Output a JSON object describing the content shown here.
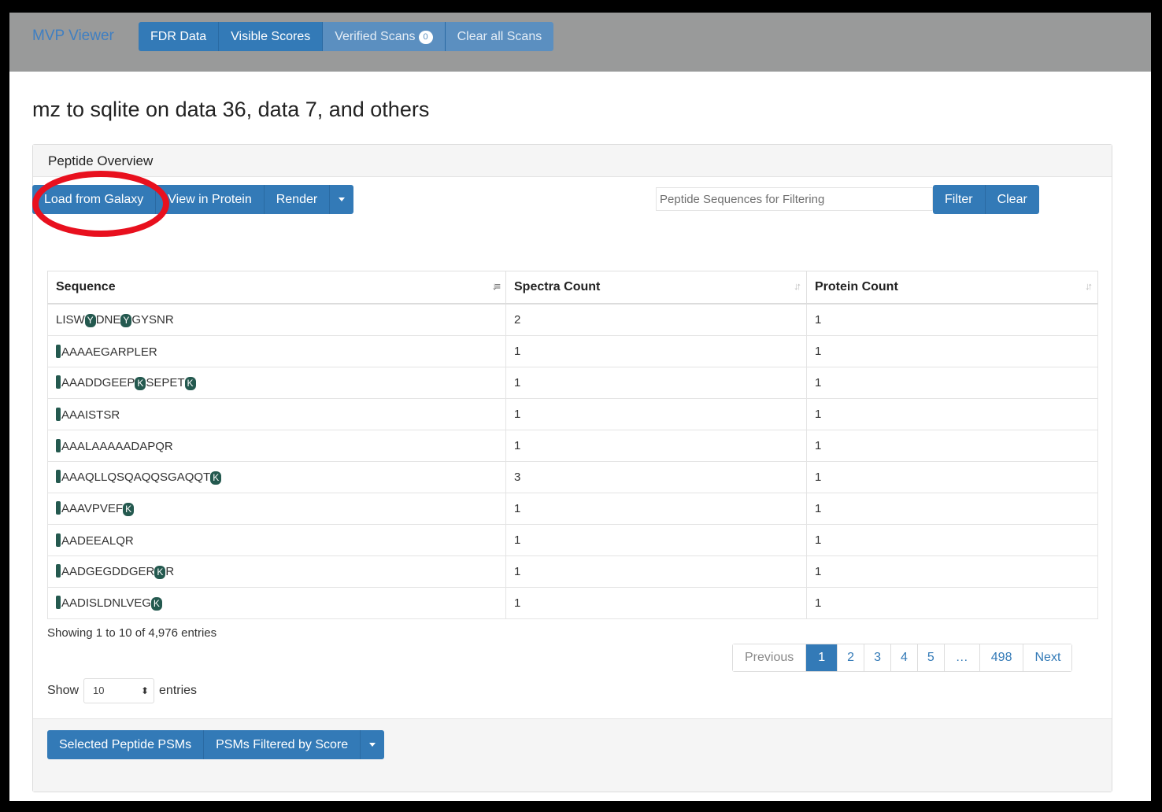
{
  "navbar": {
    "brand": "MVP Viewer",
    "items": [
      {
        "label": "FDR Data"
      },
      {
        "label": "Visible Scores"
      },
      {
        "label": "Verified Scans",
        "badge": "0"
      },
      {
        "label": "Clear all Scans"
      }
    ]
  },
  "page": {
    "title": "mz to sqlite on data 36, data 7, and others"
  },
  "panel": {
    "title": "Peptide Overview",
    "toolbar": {
      "load_label": "Load from Galaxy",
      "view_label": "View in Protein",
      "render_label": "Render"
    },
    "filter": {
      "placeholder": "Peptide Sequences for Filtering",
      "filter_label": "Filter",
      "clear_label": "Clear"
    },
    "highlight_color": "#e8101e",
    "table": {
      "columns": [
        "Sequence",
        "Spectra Count",
        "Protein Count"
      ],
      "rows": [
        {
          "sequence": [
            {
              "t": "LISW"
            },
            {
              "m": "Y"
            },
            {
              "t": "DNE"
            },
            {
              "m": "Y"
            },
            {
              "t": "GYSNR"
            }
          ],
          "spectra": "2",
          "protein": "1"
        },
        {
          "sequence": [
            {
              "n": true
            },
            {
              "t": "AAAAEGARPLER"
            }
          ],
          "spectra": "1",
          "protein": "1"
        },
        {
          "sequence": [
            {
              "n": true
            },
            {
              "t": "AAADDGEEP"
            },
            {
              "m": "K"
            },
            {
              "t": "SEPET"
            },
            {
              "m": "K"
            }
          ],
          "spectra": "1",
          "protein": "1"
        },
        {
          "sequence": [
            {
              "n": true
            },
            {
              "t": "AAAISTSR"
            }
          ],
          "spectra": "1",
          "protein": "1"
        },
        {
          "sequence": [
            {
              "n": true
            },
            {
              "t": "AAALAAAAADAPQR"
            }
          ],
          "spectra": "1",
          "protein": "1"
        },
        {
          "sequence": [
            {
              "n": true
            },
            {
              "t": "AAAQLLQSQAQQSGAQQT"
            },
            {
              "m": "K"
            }
          ],
          "spectra": "3",
          "protein": "1"
        },
        {
          "sequence": [
            {
              "n": true
            },
            {
              "t": "AAAVPVEF"
            },
            {
              "m": "K"
            }
          ],
          "spectra": "1",
          "protein": "1"
        },
        {
          "sequence": [
            {
              "n": true
            },
            {
              "t": "AADEEALQR"
            }
          ],
          "spectra": "1",
          "protein": "1"
        },
        {
          "sequence": [
            {
              "n": true
            },
            {
              "t": "AADGEGDDGER"
            },
            {
              "m": "K"
            },
            {
              "t": "R"
            }
          ],
          "spectra": "1",
          "protein": "1"
        },
        {
          "sequence": [
            {
              "n": true
            },
            {
              "t": "AADISLDNLVEG"
            },
            {
              "m": "K"
            }
          ],
          "spectra": "1",
          "protein": "1"
        }
      ]
    },
    "info": "Showing 1 to 10 of 4,976 entries",
    "pagination": {
      "previous": "Previous",
      "pages": [
        "1",
        "2",
        "3",
        "4",
        "5",
        "…",
        "498"
      ],
      "active": "1",
      "next": "Next"
    },
    "length": {
      "show": "Show",
      "value": "10",
      "entries": "entries"
    },
    "footer": {
      "selected_label": "Selected Peptide PSMs",
      "filtered_label": "PSMs Filtered by Score"
    }
  }
}
